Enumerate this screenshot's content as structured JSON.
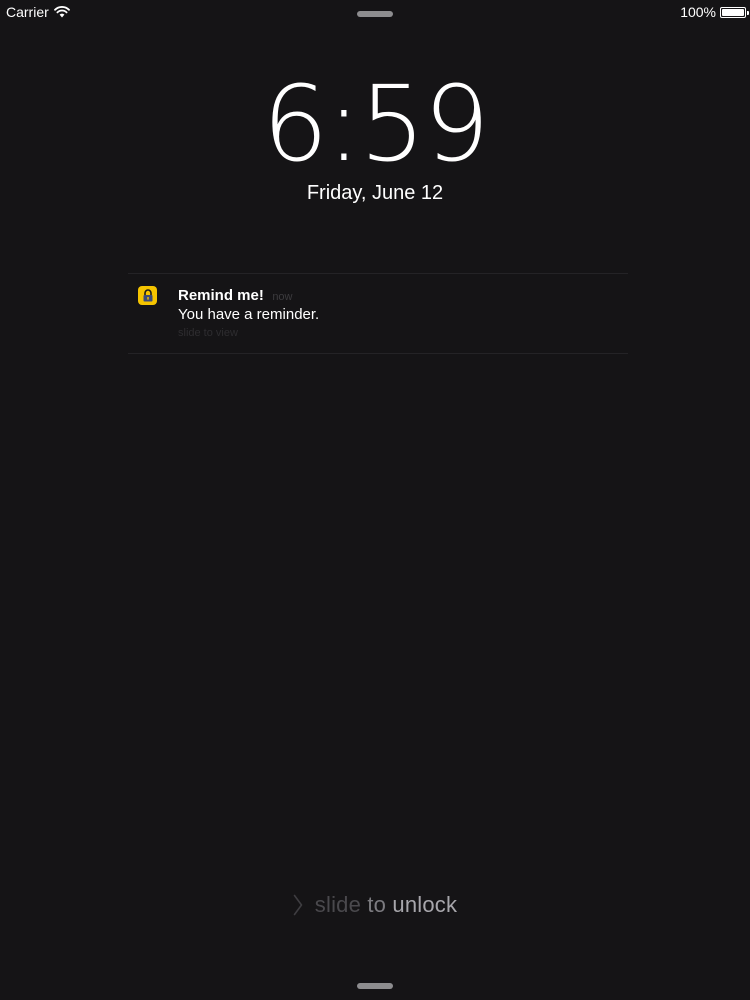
{
  "status_bar": {
    "carrier": "Carrier",
    "battery_percent": "100%",
    "battery_level": 1.0,
    "icons": [
      "wifi-icon",
      "battery-icon"
    ]
  },
  "lock_screen": {
    "time": "6:59",
    "date": "Friday, June 12"
  },
  "notification": {
    "app_icon": "lock-icon",
    "app_icon_color": "#f5c400",
    "title": "Remind me!",
    "time": "now",
    "message": "You have a reminder.",
    "action": "slide to view"
  },
  "unlock": {
    "icon": "chevron-right-icon",
    "word1": "slide",
    "word2": "to",
    "word3": "unlock"
  },
  "colors": {
    "background": "#151416",
    "text": "#ffffff"
  }
}
